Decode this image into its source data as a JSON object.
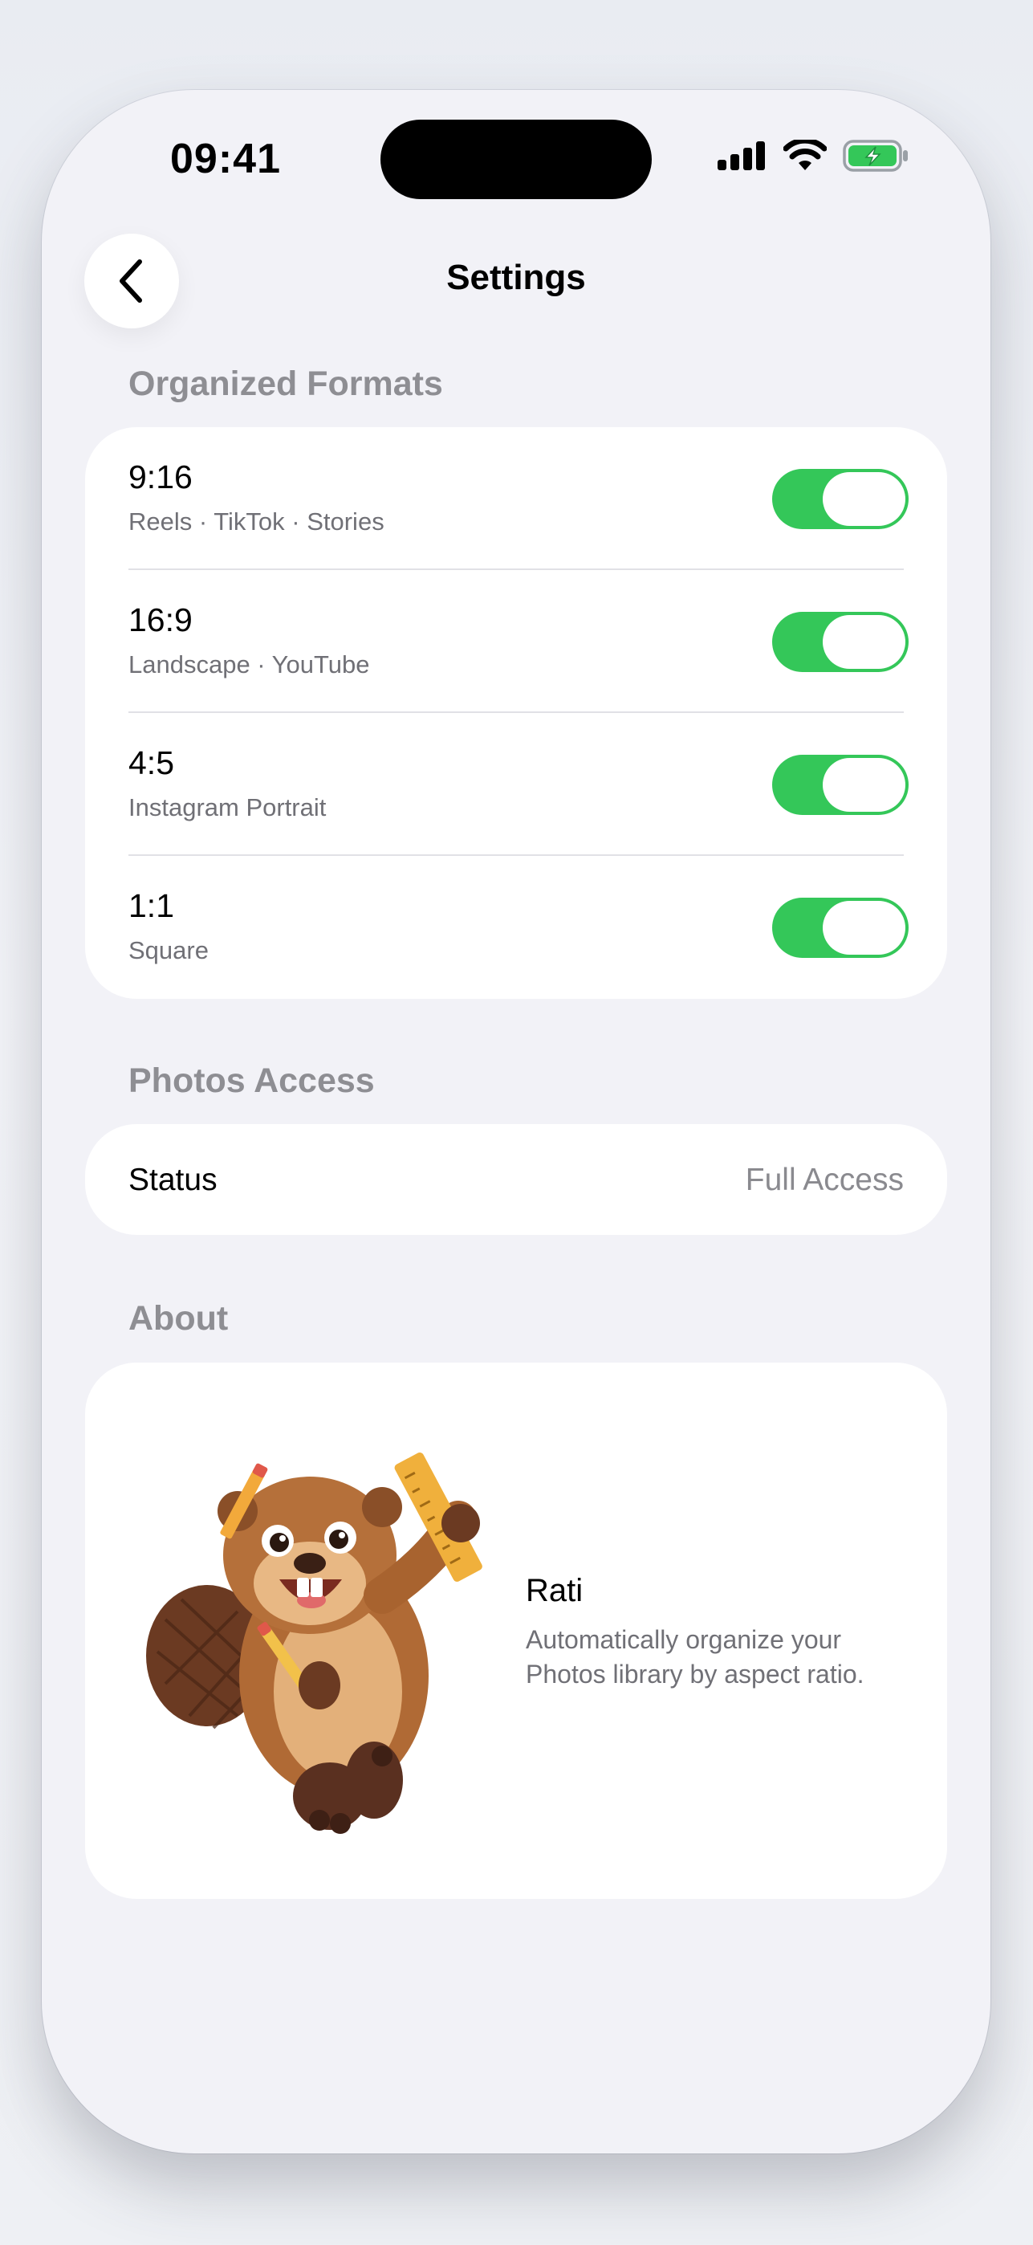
{
  "status_bar": {
    "time": "09:41",
    "icons": [
      "signal-icon",
      "wifi-icon",
      "battery-charging-icon"
    ]
  },
  "nav": {
    "back_icon": "chevron-left-icon",
    "title": "Settings"
  },
  "sections": {
    "formats": {
      "header": "Organized Formats",
      "items": [
        {
          "ratio": "9:16",
          "description": "Reels · TikTok · Stories",
          "enabled": true
        },
        {
          "ratio": "16:9",
          "description": "Landscape · YouTube",
          "enabled": true
        },
        {
          "ratio": "4:5",
          "description": "Instagram Portrait",
          "enabled": true
        },
        {
          "ratio": "1:1",
          "description": "Square",
          "enabled": true
        }
      ]
    },
    "photos_access": {
      "header": "Photos Access",
      "status_label": "Status",
      "status_value": "Full Access"
    },
    "about": {
      "header": "About",
      "mascot": "beaver-mascot-illustration",
      "app_name": "Rati",
      "app_description": "Automatically organize your Photos library by aspect ratio."
    }
  },
  "colors": {
    "toggle_on": "#34c759",
    "background": "#f2f2f7",
    "card": "#ffffff",
    "secondary_text": "#8e8e93",
    "battery_green": "#34c759"
  }
}
